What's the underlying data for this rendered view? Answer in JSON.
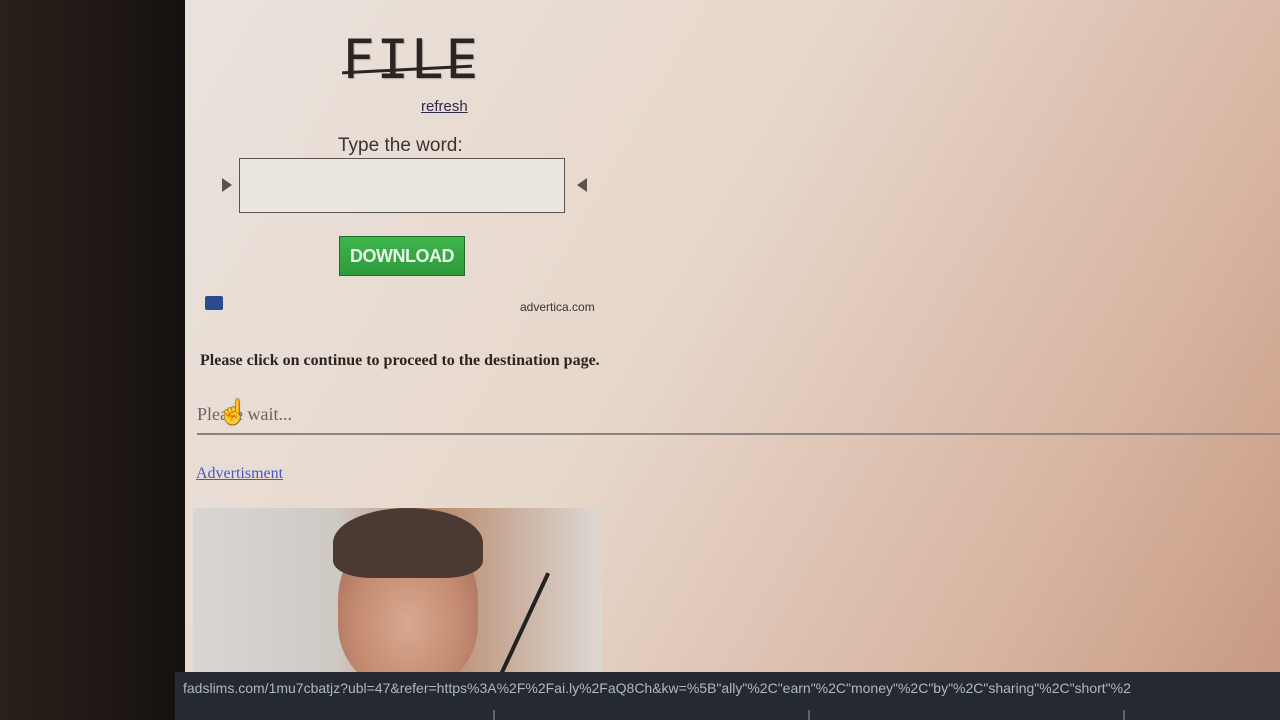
{
  "captcha": {
    "word": "FILE",
    "refresh_label": "refresh",
    "prompt_label": "Type the word:",
    "input_value": ""
  },
  "download": {
    "label": "DOWNLOAD"
  },
  "ad_network": {
    "text": "advertica.com"
  },
  "content": {
    "instruction": "Please click on continue to proceed to the destination page.",
    "please_wait": "Please wait...",
    "ad_link": "Advertisment"
  },
  "status_bar": {
    "url": "fadslims.com/1mu7cbatjz?ubl=47&refer=https%3A%2F%2Fai.ly%2FaQ8Ch&kw=%5B\"ally\"%2C\"earn\"%2C\"money\"%2C\"by\"%2C\"sharing\"%2C\"short\"%2"
  },
  "colors": {
    "download_green": "#2c9a3a",
    "link_blue": "#4a56c8",
    "status_bar_bg": "#252a31"
  },
  "icons": {
    "cursor": "hand-pointer-icon",
    "ad_badge": "ad-badge-icon"
  }
}
